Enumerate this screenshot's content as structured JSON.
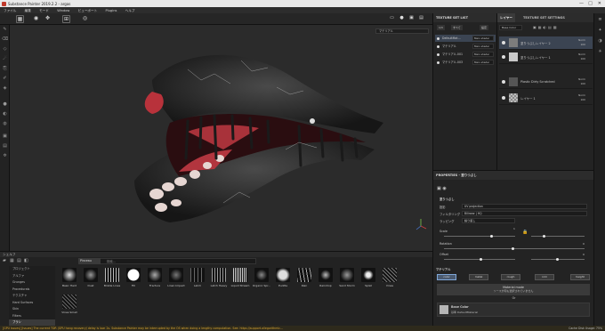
{
  "window": {
    "title": "Substance Painter 2019.2.2 - argas",
    "controls": [
      "—",
      "□",
      "✕"
    ]
  },
  "menu": [
    "ファイル",
    "編集",
    "モード",
    "Window",
    "ビューポート",
    "Plugins",
    "ヘルプ"
  ],
  "viewport": {
    "display_mode": "マテリアル"
  },
  "tools_left": [
    "brush-icon",
    "eraser-icon",
    "projection-icon",
    "smudge-icon",
    "clone-icon",
    "picker-icon",
    "polyfill-icon",
    "fill-icon"
  ],
  "texture_set_list": {
    "title": "TEXTURE SET LIST",
    "buttons": [
      "1/3",
      "すべて",
      "設定"
    ],
    "rows": [
      {
        "name": "DefaultMat...",
        "shader": "Main shader"
      },
      {
        "name": "マテリアル",
        "shader": "Main shader"
      },
      {
        "name": "マテリアル.001",
        "shader": "Main shader"
      },
      {
        "name": "マテリアル.003",
        "shader": "Main shader"
      }
    ]
  },
  "layers": {
    "tabs": [
      "レイヤー",
      "TEXTURE SET SETTINGS"
    ],
    "channel": "Base Color",
    "rows": [
      {
        "name": "塗りつぶしレイヤー 2",
        "blend": "Norm",
        "opacity": "100"
      },
      {
        "name": "塗りつぶしレイヤー 1",
        "blend": "Norm",
        "opacity": "100"
      },
      {
        "name": "Plastic Dirty Scratched",
        "blend": "Norm",
        "opacity": "100"
      },
      {
        "name": "レイヤー 1",
        "blend": "Norm",
        "opacity": "100"
      }
    ]
  },
  "properties": {
    "title": "PROPERTIES - 塗りつぶし",
    "section_fill": "塗りつぶし",
    "projection_label": "投影",
    "projection_value": "UV projection",
    "filtering_label": "フィルタリング",
    "filtering_value": "Bilinear | HQ",
    "uv_wrap_label": "ラッピング",
    "uv_wrap_value": "繰り返し",
    "scale_label": "Scale",
    "scale_value": "1",
    "rotation_label": "Rotation",
    "rotation_value": "0",
    "offset_label": "Offset",
    "offset_value": "0",
    "material_section": "マテリアル",
    "channels": [
      "color",
      "metal",
      "rough",
      "nrm",
      "height"
    ],
    "material_mode_title": "Material mode",
    "material_mode_desc": "ソースが何も選択されていません",
    "or_label": "Or",
    "base_color_title": "Base Color",
    "base_color_value": "基準 DefaultMaterial"
  },
  "shelf": {
    "title": "シェルフ",
    "filter_label": "Pinceau",
    "search_placeholder": "検索...",
    "categories": [
      "プロジェクト",
      "アルファ",
      "Grunges",
      "Procedurals",
      "テクスチャ",
      "Hard Surfaces",
      "Skin",
      "Filters",
      "ブラシ"
    ],
    "items": [
      "Basic Hard",
      "Dust",
      "Bristle Lines",
      "Fill",
      "Fracture",
      "Linen Impact",
      "Latch",
      "Latch Heavy",
      "Liquid Stream",
      "Organic Spr...",
      "Puddle",
      "Rain",
      "Raindrop",
      "Sand Storm",
      "Splat",
      "Vines",
      "Vines Small"
    ]
  },
  "status": {
    "message": "[GPU Issues] [Issues] The current TDR (GPU hang recovery) delay is low: 2s. Substance Painter may be interrupted by the OS when doing a lengthy computation. See: https://support.allegorithmic...",
    "right": "Cache Disk Usage: 75%"
  },
  "colors": {
    "accent": "#4a90d9",
    "status_warn": "#d8a531"
  }
}
